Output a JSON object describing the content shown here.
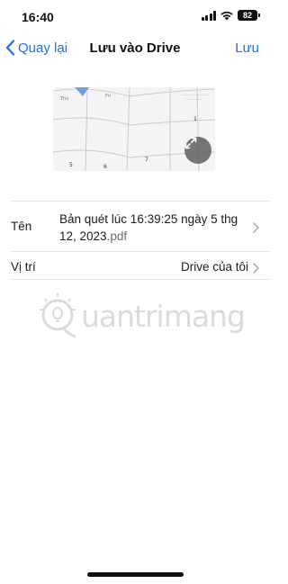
{
  "status_bar": {
    "time": "16:40",
    "battery": "82"
  },
  "nav": {
    "back_label": "Quay lại",
    "title": "Lưu vào Drive",
    "save_label": "Lưu"
  },
  "form": {
    "name_label": "Tên",
    "name_base": "Bản quét lúc 16:39:25 ngày 5 thg 12, 2023",
    "name_ext": ".pdf",
    "location_label": "Vị trí",
    "location_value": "Drive của tôi"
  },
  "preview": {
    "page_numbers": [
      "1",
      "5",
      "6",
      "7"
    ]
  },
  "watermark": {
    "text": "uantrimang"
  },
  "colors": {
    "accent": "#1a73e8",
    "separator": "#e3e3e6"
  }
}
